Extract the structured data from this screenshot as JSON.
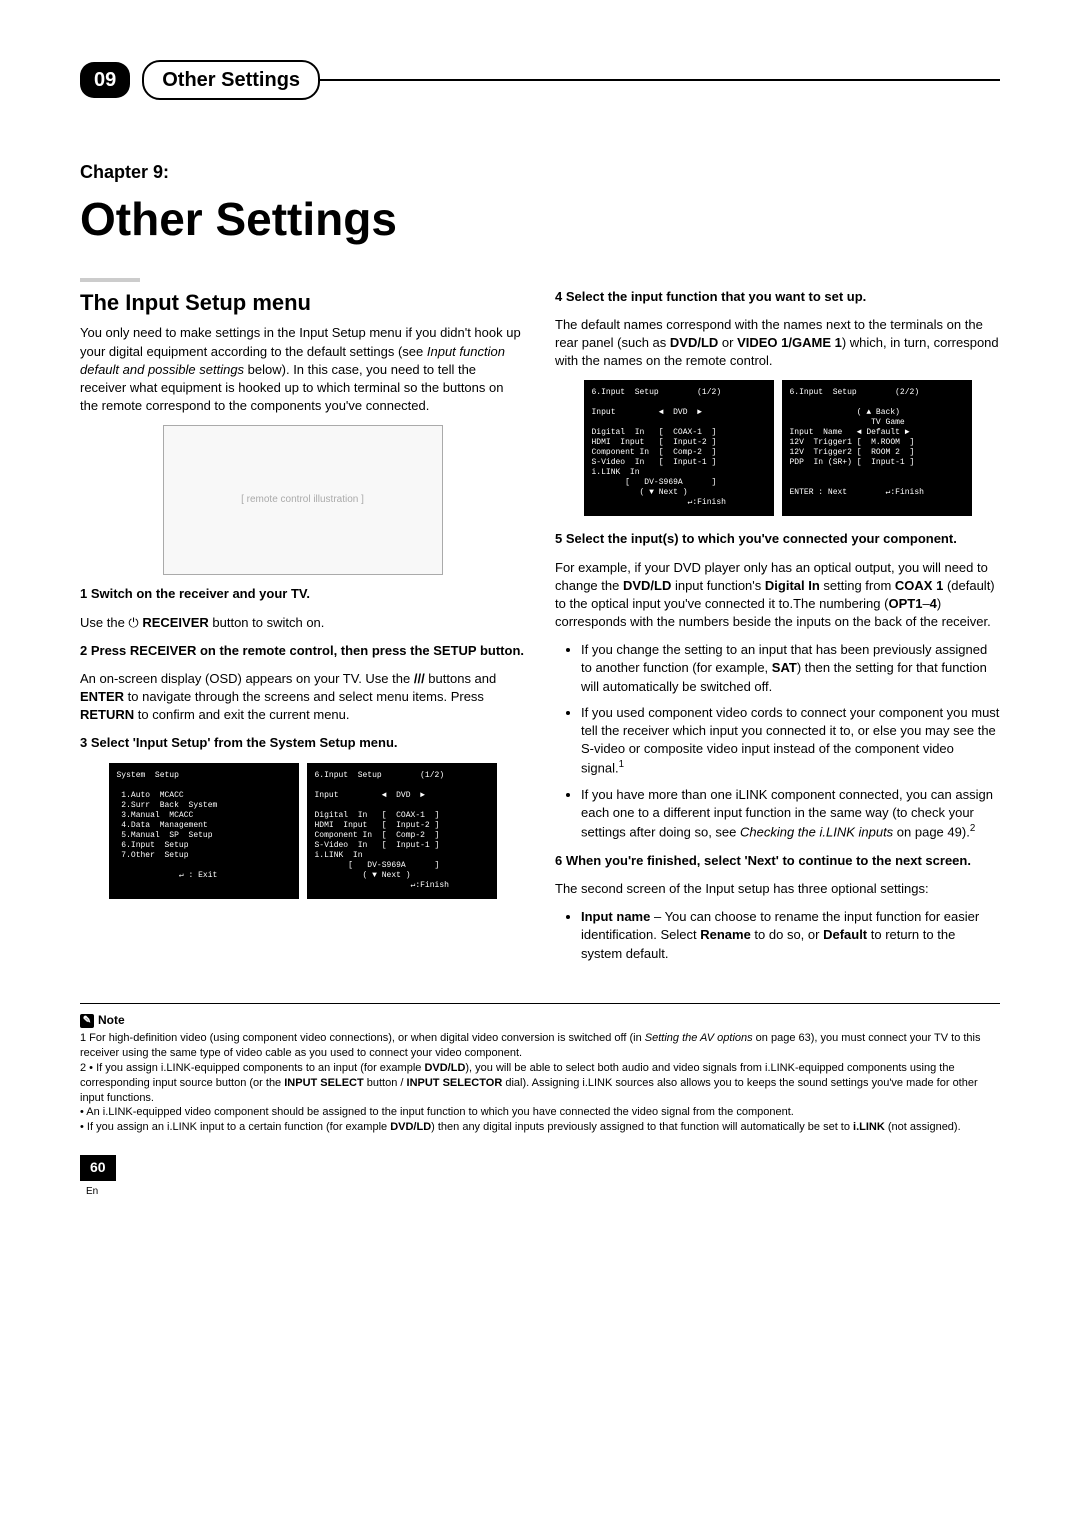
{
  "header": {
    "chapter_no": "09",
    "pill": "Other Settings"
  },
  "chapter": {
    "label": "Chapter 9:",
    "title": "Other Settings"
  },
  "left": {
    "section_title": "The Input Setup menu",
    "intro_a": "You only need to make settings in the Input Setup menu if you didn't hook up your digital equipment according to the default settings (see ",
    "intro_ital": "Input function default and possible settings",
    "intro_b": " below). In this case, you need to tell the receiver what equipment is hooked up to which terminal so the buttons on the remote correspond to the components you've connected.",
    "fig_remote": "[ remote control illustration ]",
    "s1_head": "1   Switch on the receiver and your TV.",
    "s1_a": "Use the ⏻ ",
    "s1_bold": "RECEIVER",
    "s1_b": " button to switch on.",
    "s2_head": "2   Press RECEIVER on the remote control, then press the SETUP button.",
    "s2_a": "An on-screen display (OSD) appears on your TV. Use the ",
    "s2_b": "///",
    "s2_c": " buttons and ",
    "s2_bold1": "ENTER",
    "s2_d": " to navigate through the screens and select menu items. Press ",
    "s2_bold2": "RETURN",
    "s2_e": " to confirm and exit the current menu.",
    "s3_head": "3   Select 'Input Setup' from the System Setup menu.",
    "osd1": "System  Setup\n\n 1.Auto  MCACC\n 2.Surr  Back  System\n 3.Manual  MCACC\n 4.Data  Management\n 5.Manual  SP  Setup\n 6.Input  Setup\n 7.Other  Setup\n\n             ↵ : Exit",
    "osd2": "6.Input  Setup        (1/2)\n\nInput         ◄  DVD  ►\n\nDigital  In   [  COAX-1  ]\nHDMI  Input   [  Input-2 ]\nComponent In  [  Comp-2  ]\nS-Video  In   [  Input-1 ]\ni.LINK  In\n       [   DV-S969A      ]\n          ( ▼ Next )\n                    ↵:Finish"
  },
  "right": {
    "s4_head": "4   Select the input function that you want to set up.",
    "s4_a": "The default names correspond with the names next to the terminals on the rear panel (such as ",
    "s4_b1": "DVD/LD",
    "s4_b": " or ",
    "s4_b2": "VIDEO 1/GAME 1",
    "s4_c": ") which, in turn, correspond with the names on the remote control.",
    "osd3": "6.Input  Setup        (1/2)\n\nInput         ◄  DVD  ►\n\nDigital  In   [  COAX-1  ]\nHDMI  Input   [  Input-2 ]\nComponent In  [  Comp-2  ]\nS-Video  In   [  Input-1 ]\ni.LINK  In\n       [   DV-S969A      ]\n          ( ▼ Next )\n                    ↵:Finish",
    "osd4": "6.Input  Setup        (2/2)\n\n              ( ▲ Back)\n                 TV Game\nInput  Name   ◄ Default ►\n12V  Trigger1 [  M.ROOM  ]\n12V  Trigger2 [  ROOM 2  ]\nPDP  In (SR+) [  Input-1 ]\n\n\nENTER : Next        ↵:Finish",
    "s5_head": "5   Select the input(s) to which you've connected your component.",
    "s5_a": "For example, if your DVD player only has an optical output, you will need to change the ",
    "s5_b1": "DVD/LD",
    "s5_b": " input function's ",
    "s5_b2": "Digital In",
    "s5_c": " setting from ",
    "s5_b3": "COAX 1",
    "s5_d": " (default) to the optical input you've connected it to.The numbering (",
    "s5_b4": "OPT1",
    "s5_e": "–",
    "s5_b5": "4",
    "s5_f": ") corresponds with the numbers beside the inputs on the back of the receiver.",
    "bul1_a": "If you change the setting to an input that has been previously assigned to another function (for example, ",
    "bul1_b": "SAT",
    "bul1_c": ") then the setting for that function will automatically be switched off.",
    "bul2": "If you used component video cords to connect your component you must tell the receiver which input you connected it to, or else you may see the S-video or composite video input instead of the component video signal.",
    "bul3_a": "If you have more than one iLINK component connected, you can assign each one to a different input function in the same way (to check your settings after doing so, see ",
    "bul3_ital": "Checking the i.LINK inputs",
    "bul3_b": " on page 49).",
    "s6_head": "6   When you're finished, select 'Next' to continue to the next screen.",
    "s6_p": "The second screen of the Input setup has three optional settings:",
    "bul4_b1": "Input name",
    "bul4_a": " – You can choose to rename the input function for easier identification. Select ",
    "bul4_b2": "Rename",
    "bul4_b": " to do so, or ",
    "bul4_b3": "Default",
    "bul4_c": " to return to the system default."
  },
  "notes": {
    "label": "Note",
    "n1_a": "1  For high-definition video (using component video connections), or when digital video conversion is switched off (in ",
    "n1_ital": "Setting the AV options",
    "n1_b": " on page 63), you must connect your TV to this receiver using the same type of video cable as you used to connect your video component.",
    "n2_a": "2  • If you assign i.LINK-equipped components to an input (for example ",
    "n2_b1": "DVD/LD",
    "n2_b": "), you will be able to select both audio and video signals from i.LINK-equipped components using the corresponding input source button (or the ",
    "n2_b2": "INPUT SELECT",
    "n2_c": " button / ",
    "n2_b3": "INPUT SELECTOR",
    "n2_d": " dial). Assigning i.LINK sources also allows you to keeps the sound settings you've made for other input functions.",
    "n3": "   • An i.LINK-equipped video component should be assigned to the input function to which you have connected the video signal from the component.",
    "n4_a": "   • If you assign an i.LINK input to a certain function (for example ",
    "n4_b1": "DVD/LD",
    "n4_b": ") then any digital inputs previously assigned to that function will automatically be set to ",
    "n4_b2": "i.LINK",
    "n4_c": " (not assigned)."
  },
  "footer": {
    "page": "60",
    "lang": "En"
  }
}
